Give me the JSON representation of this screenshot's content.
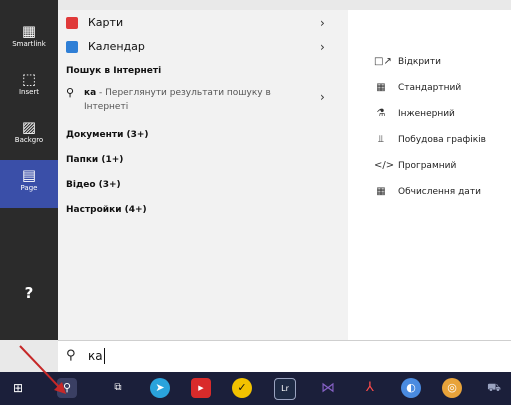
{
  "appbar": {
    "items": [
      {
        "label": "Smartlink",
        "glyph": "▦"
      },
      {
        "label": "Insert",
        "glyph": "⬚"
      },
      {
        "label": "Backgro",
        "glyph": "▨"
      },
      {
        "label": "Page",
        "glyph": "▤"
      }
    ],
    "help_glyph": "?"
  },
  "search_panel": {
    "apps": [
      {
        "label": "Карти",
        "icon_color": "#e03a3a"
      },
      {
        "label": "Календар",
        "icon_color": "#2f7fd6"
      }
    ],
    "web_section": "Пошук в Інтернеті",
    "web_query": "ка",
    "web_suffix": " - Переглянути результати пошуку в Інтернеті",
    "sections": [
      "Документи (3+)",
      "Папки (1+)",
      "Відео (3+)",
      "Настройки (4+)"
    ]
  },
  "preview": {
    "items": [
      {
        "icon": "□↗",
        "label": "Відкрити"
      },
      {
        "icon": "▦",
        "label": "Стандартний"
      },
      {
        "icon": "⚗",
        "label": "Інженерний"
      },
      {
        "icon": "⫫",
        "label": "Побудова графіків"
      },
      {
        "icon": "</>",
        "label": "Програмний"
      },
      {
        "icon": "▦",
        "label": "Обчислення дати"
      }
    ]
  },
  "searchbar": {
    "query": "ка"
  },
  "taskbar": {
    "colors": {
      "start": "#ffffff",
      "telegram": "#2aa3dc",
      "youtube": "#d92b2b",
      "norton": "#f2c200",
      "lightroom": "#1e2a44",
      "vs": "#8661c5",
      "acrobat": "#d32f2f",
      "browser": "#4a8be0",
      "chrome": "#e8a33a",
      "app": "#9aa3c0"
    }
  }
}
